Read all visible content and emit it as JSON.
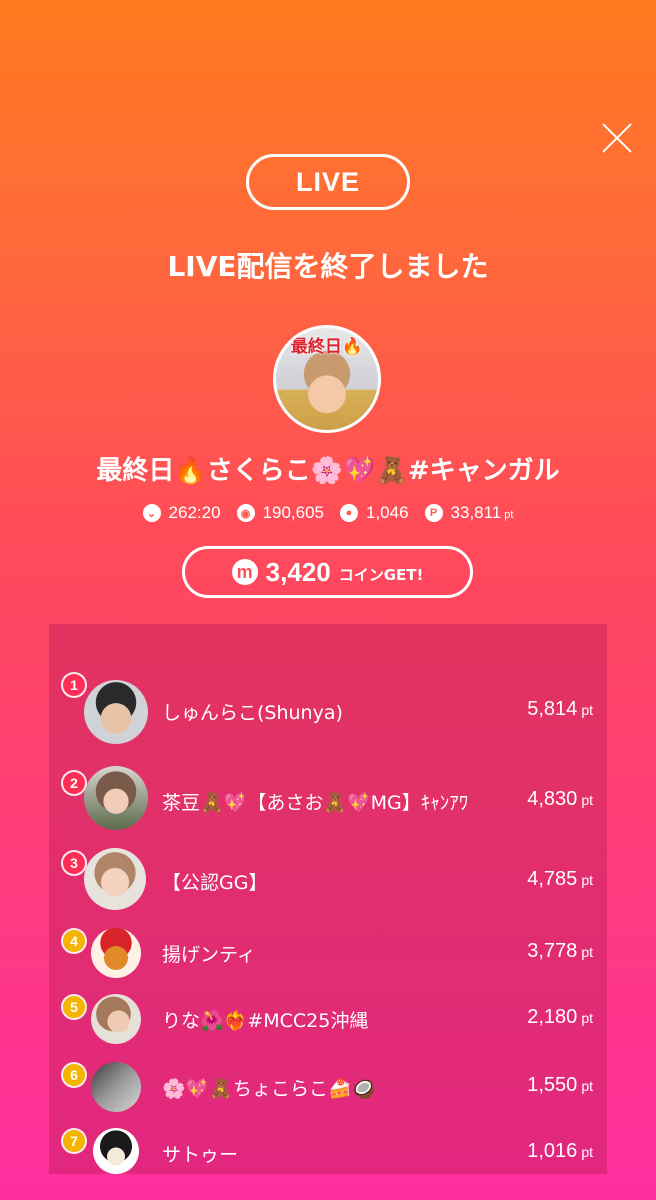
{
  "header": {
    "close_icon": "close-icon",
    "live_label": "LIVE",
    "title": "LIVE配信を終了しました"
  },
  "streamer": {
    "avatar_tag": "最終日🔥",
    "name": "最終日🔥さくらこ🌸💖🧸#キャンガル"
  },
  "stats": {
    "duration": "262:20",
    "views": "190,605",
    "comments": "1,046",
    "points": "33,811",
    "points_unit": "pt"
  },
  "coins": {
    "icon": "m",
    "amount": "3,420",
    "suffix": "コインGET!"
  },
  "ranking": [
    {
      "rank": "1",
      "name": "しゅんらこ(Shunya)",
      "points": "5,814",
      "unit": "pt",
      "badge_color": "#ff2d55"
    },
    {
      "rank": "2",
      "name": "茶豆🧸💖【あさお🧸💖MG】ｷｬﾝｱﾜ",
      "points": "4,830",
      "unit": "pt",
      "badge_color": "#ff2d55"
    },
    {
      "rank": "3",
      "name": "【公認GG】",
      "points": "4,785",
      "unit": "pt",
      "badge_color": "#ff2d55"
    },
    {
      "rank": "4",
      "name": "揚げンティ",
      "points": "3,778",
      "unit": "pt",
      "badge_color": "#f5b400"
    },
    {
      "rank": "5",
      "name": "りな🌺❤️‍🔥#MCC25沖縄",
      "points": "2,180",
      "unit": "pt",
      "badge_color": "#f5b400"
    },
    {
      "rank": "6",
      "name": "🌸💖🧸ちょこらこ🍰🥥",
      "points": "1,550",
      "unit": "pt",
      "badge_color": "#f5b400"
    },
    {
      "rank": "7",
      "name": "サトゥー",
      "points": "1,016",
      "unit": "pt",
      "badge_color": "#f5b400"
    }
  ]
}
